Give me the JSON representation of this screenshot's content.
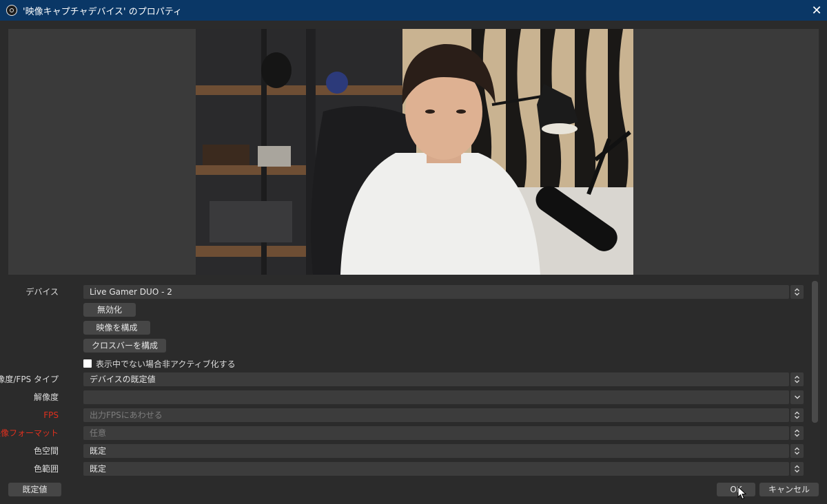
{
  "window": {
    "title": "'映像キャプチャデバイス' のプロパティ",
    "close_glyph": "✕"
  },
  "form": {
    "device": {
      "label": "デバイス",
      "value": "Live Gamer DUO - 2"
    },
    "buttons": {
      "deactivate": "無効化",
      "configure_video": "映像を構成",
      "configure_crossbar": "クロスバーを構成"
    },
    "deactivate_when_hidden": {
      "label": "表示中でない場合非アクティブ化する",
      "checked": false
    },
    "res_fps_type": {
      "label": "解像度/FPS タイプ",
      "value": "デバイスの既定値"
    },
    "resolution": {
      "label": "解像度",
      "value": ""
    },
    "fps": {
      "label": "FPS",
      "value": "出力FPSにあわせる"
    },
    "video_format": {
      "label": "映像フォーマット",
      "value": "任意"
    },
    "color_space": {
      "label": "色空間",
      "value": "既定"
    },
    "color_range": {
      "label": "色範囲",
      "value": "既定"
    }
  },
  "footer": {
    "defaults": "既定値",
    "ok": "OK",
    "cancel": "キャンセル"
  },
  "colors": {
    "titlebar": "#0a3766",
    "background": "#2b2b2b",
    "field": "#3c3c3c",
    "warning_label": "#e0301e"
  }
}
